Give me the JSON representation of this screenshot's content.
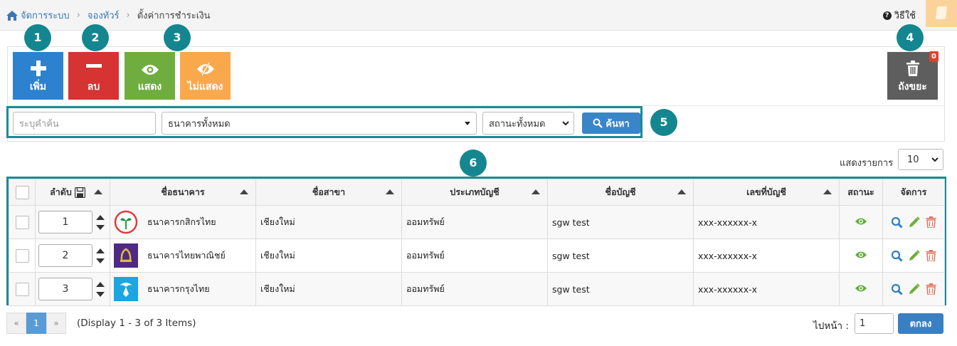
{
  "breadcrumb": {
    "items": [
      "จัดการระบบ",
      "จองทัวร์"
    ],
    "current": "ตั้งค่าการชำระเงิน"
  },
  "help": {
    "label": "วิธีใช้"
  },
  "toolbar": {
    "add_label": "เพิ่ม",
    "delete_label": "ลบ",
    "show_label": "แสดง",
    "hide_label": "ไม่แสดง",
    "trash_label": "ถังขยะ",
    "trash_count": "0"
  },
  "callouts": [
    "1",
    "2",
    "3",
    "4",
    "5",
    "6"
  ],
  "search": {
    "keyword_placeholder": "ระบุคำค้น",
    "bank_select": "ธนาคารทั้งหมด",
    "status_select": "สถานะทั้งหมด",
    "search_label": "ค้นหา"
  },
  "per_page": {
    "label": "แสดงรายการ",
    "value": "10"
  },
  "table": {
    "headers": {
      "order": "ลำดับ",
      "bank": "ชื่อธนาคาร",
      "branch": "ชื่อสาขา",
      "type": "ประเภทบัญชี",
      "acc_name": "ชื่อบัญชี",
      "acc_no": "เลขที่บัญชี",
      "status": "สถานะ",
      "manage": "จัดการ"
    },
    "rows": [
      {
        "order": "1",
        "bank": "ธนาคารกสิกรไทย",
        "branch": "เชียงใหม่",
        "type": "ออมทรัพย์",
        "acc_name": "sgw test",
        "acc_no": "xxx-xxxxxx-x",
        "logo": "kbank-logo"
      },
      {
        "order": "2",
        "bank": "ธนาคารไทยพาณิชย์",
        "branch": "เชียงใหม่",
        "type": "ออมทรัพย์",
        "acc_name": "sgw test",
        "acc_no": "xxx-xxxxxx-x",
        "logo": "scb-logo"
      },
      {
        "order": "3",
        "bank": "ธนาคารกรุงไทย",
        "branch": "เชียงใหม่",
        "type": "ออมทรัพย์",
        "acc_name": "sgw test",
        "acc_no": "xxx-xxxxxx-x",
        "logo": "ktb-logo"
      }
    ]
  },
  "pagination": {
    "prev": "«",
    "page": "1",
    "next": "»",
    "display": "(Display 1 - 3 of 3 Items)",
    "goto_label": "ไปหน้า :",
    "goto_value": "1",
    "ok_label": "ตกลง"
  },
  "colors": {
    "accent": "#1a8c94",
    "add": "#2d82cf",
    "delete": "#d63332",
    "show": "#6fae3e",
    "hide": "#f9a94b",
    "trash": "#5e5e5e"
  }
}
